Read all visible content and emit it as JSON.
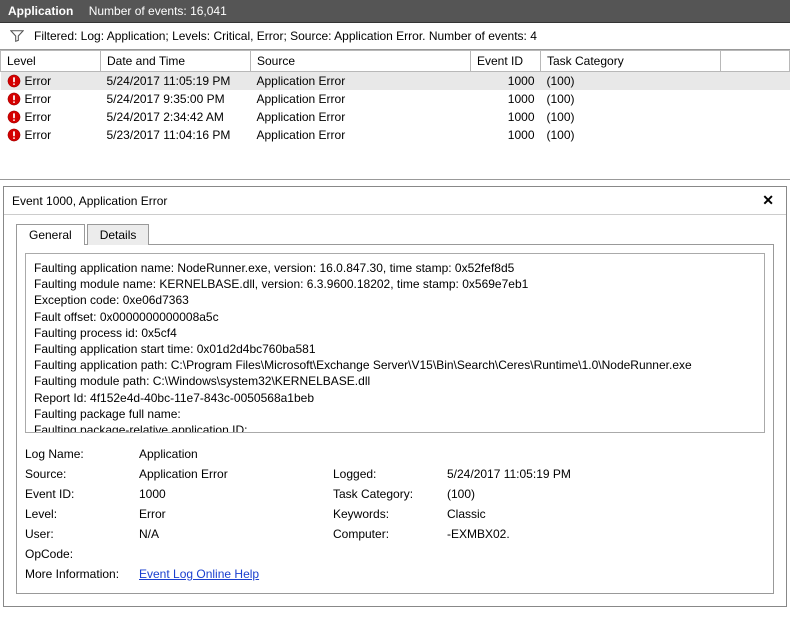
{
  "titleBar": {
    "appName": "Application",
    "eventsLabel": "Number of events: 16,041"
  },
  "filterText": "Filtered: Log: Application; Levels: Critical, Error; Source: Application Error. Number of events: 4",
  "columns": {
    "level": "Level",
    "date": "Date and Time",
    "source": "Source",
    "eventId": "Event ID",
    "taskCat": "Task Category"
  },
  "rows": [
    {
      "level": "Error",
      "date": "5/24/2017 11:05:19 PM",
      "source": "Application Error",
      "eventId": "1000",
      "taskCat": "(100)"
    },
    {
      "level": "Error",
      "date": "5/24/2017 9:35:00 PM",
      "source": "Application Error",
      "eventId": "1000",
      "taskCat": "(100)"
    },
    {
      "level": "Error",
      "date": "5/24/2017 2:34:42 AM",
      "source": "Application Error",
      "eventId": "1000",
      "taskCat": "(100)"
    },
    {
      "level": "Error",
      "date": "5/23/2017 11:04:16 PM",
      "source": "Application Error",
      "eventId": "1000",
      "taskCat": "(100)"
    }
  ],
  "detailsTitle": "Event 1000, Application Error",
  "tabs": {
    "general": "General",
    "details": "Details"
  },
  "description": [
    "Faulting application name: NodeRunner.exe, version: 16.0.847.30, time stamp: 0x52fef8d5",
    "Faulting module name: KERNELBASE.dll, version: 6.3.9600.18202, time stamp: 0x569e7eb1",
    "Exception code: 0xe06d7363",
    "Fault offset: 0x0000000000008a5c",
    "Faulting process id: 0x5cf4",
    "Faulting application start time: 0x01d2d4bc760ba581",
    "Faulting application path: C:\\Program Files\\Microsoft\\Exchange Server\\V15\\Bin\\Search\\Ceres\\Runtime\\1.0\\NodeRunner.exe",
    "Faulting module path: C:\\Windows\\system32\\KERNELBASE.dll",
    "Report Id: 4f152e4d-40bc-11e7-843c-0050568a1beb",
    "Faulting package full name:",
    "Faulting package-relative application ID:"
  ],
  "props": {
    "logNameLabel": "Log Name:",
    "logName": "Application",
    "sourceLabel": "Source:",
    "source": "Application Error",
    "loggedLabel": "Logged:",
    "logged": "5/24/2017 11:05:19 PM",
    "eventIdLabel": "Event ID:",
    "eventId": "1000",
    "taskCatLabel": "Task Category:",
    "taskCat": "(100)",
    "levelLabel": "Level:",
    "level": "Error",
    "keywordsLabel": "Keywords:",
    "keywords": "Classic",
    "userLabel": "User:",
    "user": "N/A",
    "computerLabel": "Computer:",
    "computer": "-EXMBX02.",
    "opcodeLabel": "OpCode:",
    "opcode": "",
    "moreInfoLabel": "More Information:",
    "moreInfoLink": "Event Log Online Help"
  }
}
